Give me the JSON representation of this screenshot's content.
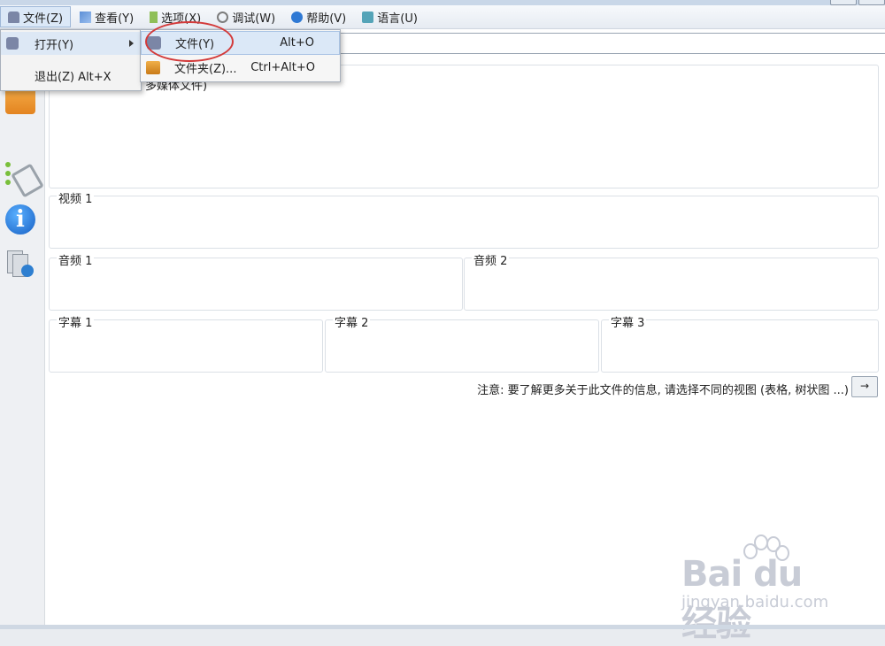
{
  "menubar": {
    "items": [
      {
        "label": "文件(Z)",
        "icon": "bell-icon"
      },
      {
        "label": "查看(Y)",
        "icon": "view-icon"
      },
      {
        "label": "选项(X)",
        "icon": "options-icon"
      },
      {
        "label": "调试(W)",
        "icon": "debug-icon"
      },
      {
        "label": "帮助(V)",
        "icon": "help-icon"
      },
      {
        "label": "语言(U)",
        "icon": "language-icon"
      }
    ]
  },
  "file_menu": {
    "open_label": "打开(Y)",
    "exit_label": "退出(Z) Alt+X"
  },
  "open_submenu": {
    "file_label": "文件(Y)",
    "file_shortcut": "Alt+O",
    "folder_label": "文件夹(Z)...",
    "folder_shortcut": "Ctrl+Alt+O"
  },
  "main": {
    "combo_button": "...",
    "general_text": "多媒体文件)",
    "video_label": "视频 1",
    "audio1_label": "音频 1",
    "audio2_label": "音频 2",
    "sub1_label": "字幕 1",
    "sub2_label": "字幕 2",
    "sub3_label": "字幕 3",
    "notice": "注意: 要了解更多关于此文件的信息, 请选择不同的视图 (表格, 树状图 ...)",
    "arrow_button": "→"
  },
  "watermark": {
    "brand": "Bai du 经验",
    "url": "jingyan.baidu.com"
  },
  "colors": {
    "highlight": "#dbe8f7",
    "annotation_circle": "#d33a3a",
    "panel_border": "#dbe0e6"
  }
}
